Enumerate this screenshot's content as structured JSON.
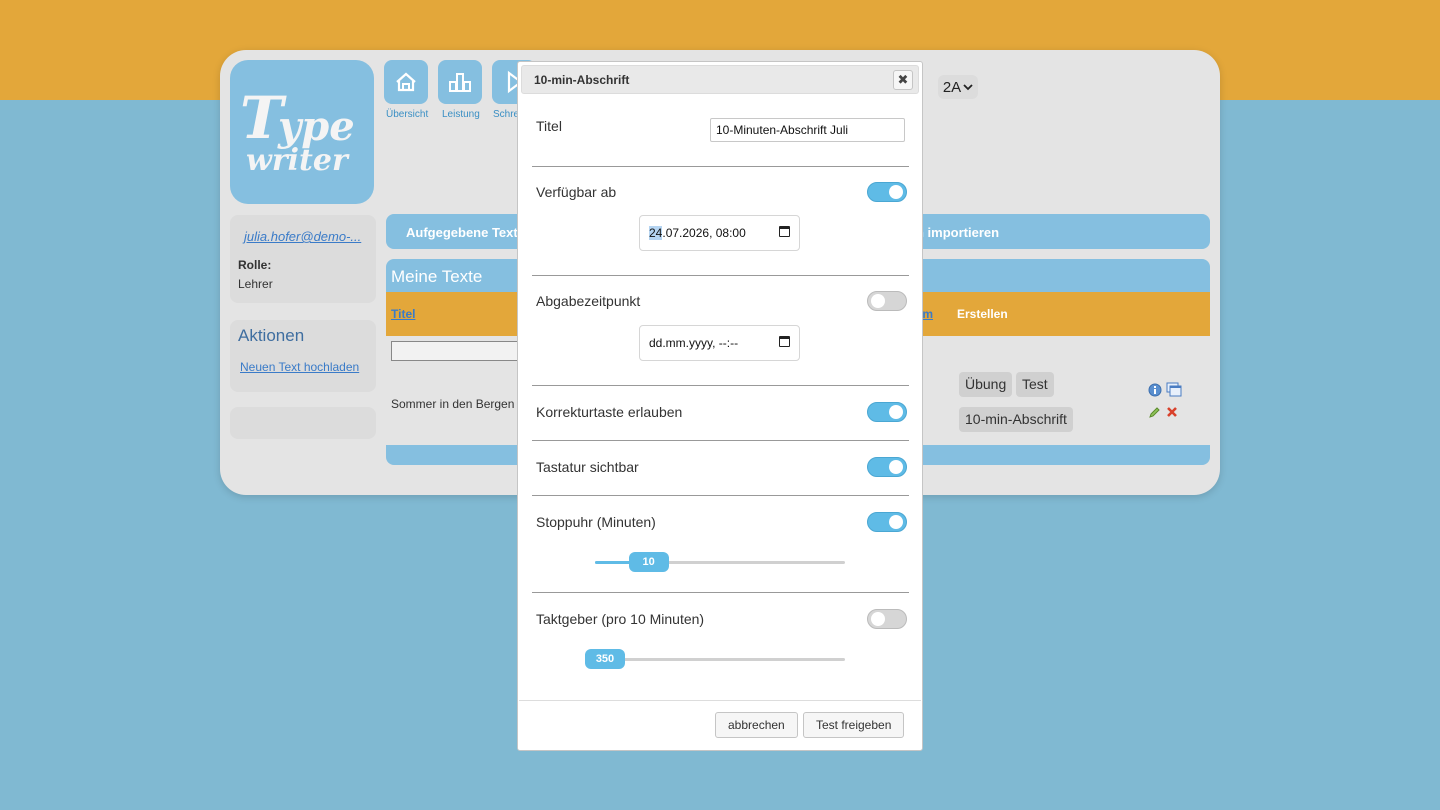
{
  "app": {
    "logo_line1": "Type",
    "logo_line2": "writer",
    "nav": [
      {
        "label": "Übersicht",
        "icon": "home-icon"
      },
      {
        "label": "Leistung",
        "icon": "bars-icon"
      },
      {
        "label": "Schre",
        "icon": "play-icon"
      }
    ],
    "class_select": "2A"
  },
  "user": {
    "email": "julia.hofer@demo-...",
    "role_label": "Rolle:",
    "role_value": "Lehrer"
  },
  "actions": {
    "title": "Aktionen",
    "upload_link": "Neuen Text hochladen"
  },
  "tabs": {
    "assigned": "Aufgegebene Text",
    "import": "n importieren"
  },
  "texts_panel": {
    "title": "Meine Texte",
    "col_title": "Titel",
    "col_date": "tum",
    "col_create": "Erstellen",
    "row_title": "Sommer in den Bergen",
    "chips": [
      "Übung",
      "Test",
      "10-min-Abschrift"
    ]
  },
  "modal": {
    "title": "10-min-Abschrift",
    "close_glyph": "✖",
    "title_label": "Titel",
    "title_value": "10-Minuten-Abschrift Juli",
    "available_label": "Verfügbar ab",
    "available_on": true,
    "available_day": "24",
    "available_rest": ".07.2026, 08:00",
    "deadline_label": "Abgabezeitpunkt",
    "deadline_on": false,
    "deadline_placeholder": "dd.mm.yyyy, --:--",
    "correction_label": "Korrekturtaste erlauben",
    "correction_on": true,
    "keyboard_label": "Tastatur sichtbar",
    "keyboard_on": true,
    "stopwatch_label": "Stoppuhr (Minuten)",
    "stopwatch_on": true,
    "stopwatch_value": "10",
    "stopwatch_fraction": 0.16,
    "pacer_label": "Taktgeber (pro 10 Minuten)",
    "pacer_on": false,
    "pacer_value": "350",
    "pacer_fraction": 0.0,
    "cancel_label": "abbrechen",
    "submit_label": "Test freigeben"
  },
  "colors": {
    "accent_blue": "#85bfe0",
    "accent_orange": "#e3a73a",
    "toggle_on": "#5fbbe6"
  }
}
